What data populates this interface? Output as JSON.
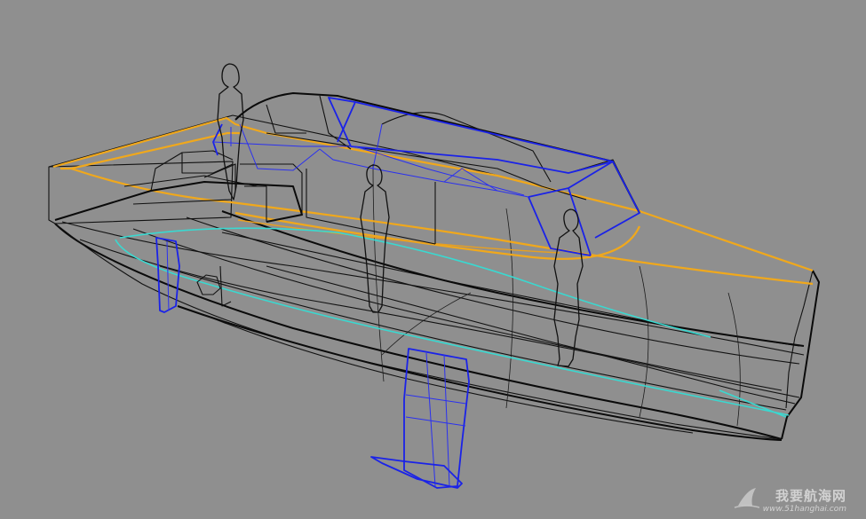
{
  "watermark": {
    "logo_icon": "sail-logo-icon",
    "text": "我要航海网",
    "url": "www.51hanghai.com"
  },
  "colors": {
    "background": "#8f8f8f",
    "hull_lines": "#111111",
    "sheer_line": "#f0a81c",
    "cabin_and_appendages": "#1a22e8",
    "waterline": "#3ad8d0"
  }
}
